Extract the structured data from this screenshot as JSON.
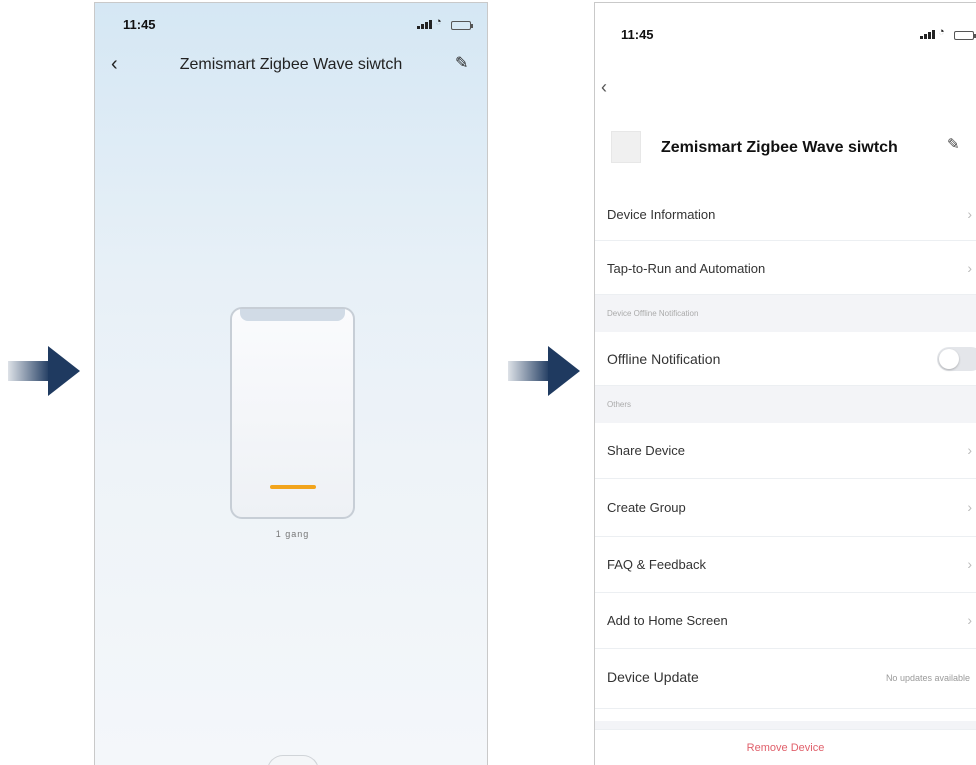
{
  "arrows": {
    "color": "#1f3a60"
  },
  "phone1": {
    "time": "11:45",
    "title": "Zemismart Zigbee Wave siwtch",
    "back_icon": "chevron-left-icon",
    "edit_icon": "pencil-icon",
    "switch": {
      "label": "1 gang",
      "led_color": "#f2a41c"
    }
  },
  "phone2": {
    "time": "11:45",
    "back_icon": "chevron-left-icon",
    "device_name": "Zemismart Zigbee Wave siwtch",
    "edit_icon": "pencil-icon",
    "rows": {
      "device_information": "Device Information",
      "tap_to_run": "Tap-to-Run and Automation",
      "offline_section": "Device Offline Notification",
      "offline_notification": "Offline Notification",
      "offline_toggle_on": false,
      "others_section": "Others",
      "share_device": "Share Device",
      "create_group": "Create Group",
      "faq": "FAQ & Feedback",
      "add_home_screen": "Add to Home Screen",
      "device_update": "Device Update",
      "device_update_value": "No updates available"
    },
    "remove_device": "Remove Device",
    "remove_color": "#e0606b"
  }
}
